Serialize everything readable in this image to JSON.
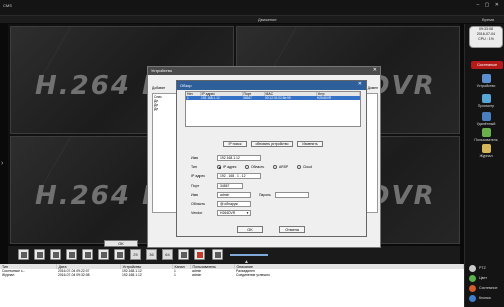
{
  "app": {
    "title": "CMS",
    "menu_center": "Движение",
    "menu_right": "Время"
  },
  "watermark": "H.264 DVR",
  "clock": {
    "time": "09:33:08",
    "date": "2016-07-04",
    "cpu": "CPU : 1%"
  },
  "side_panel": {
    "header": "Системные",
    "buttons": [
      "Устройство",
      "Просмотр",
      "Удалённый",
      "Пользователь",
      "Журнал"
    ],
    "bottom": [
      "PTZ",
      "Цвет",
      "Системное",
      "Кнопка"
    ]
  },
  "toolbar": {
    "nums": [
      "25",
      "36",
      "64"
    ],
    "left_arrow": "›",
    "collapse": "▲"
  },
  "log": {
    "headers": [
      "Тип",
      "Дата",
      "Устройство",
      "Канал",
      "Пользователь",
      "Описание"
    ],
    "rows": [
      [
        "Системные з...",
        "2016-07-04 09:22:07",
        "192.168.1.12",
        "1",
        "admin",
        "Разъединен"
      ],
      [
        "Журнал",
        "2016-07-04 09:32:08",
        "192.168.1.12",
        "1",
        "admin",
        "Соединение успешно"
      ]
    ]
  },
  "outer_dialog": {
    "title": "Устройство",
    "col_left": "Добавит",
    "col_right": "Домен",
    "tree": [
      "Спис",
      "Де",
      "Де",
      "Де"
    ],
    "ok": "OK"
  },
  "inner_dialog": {
    "title": "Обзор",
    "table": {
      "headers": [
        "Нет.",
        "IP адрес",
        "Порт",
        "MAC",
        "Устр"
      ],
      "rows": [
        [
          "1",
          "192.168.1.12",
          "34567",
          "00:12:31:02:8e:99",
          "H264DVR"
        ]
      ]
    },
    "buttons": {
      "search": "IP поиск",
      "refresh": "обновить устройство",
      "modify": "Изменить",
      "ok": "OK",
      "cancel": "Отмена"
    },
    "form": {
      "name_label": "Имя",
      "name_value": "192.168.1.12",
      "type_label": "Тип",
      "type_options": [
        "IP адрес",
        "Область",
        "ARSP",
        "Cloud"
      ],
      "ip_label": "IP адрес",
      "ip_value": "192 . 168 . 1 . 12",
      "port_label": "Порт",
      "port_value": "34567",
      "user_label": "Имя",
      "user_value": "admin",
      "password_label": "Пароль",
      "area_label": "Область",
      "area_value": "@:обнаруж",
      "vendor_label": "Vendor",
      "vendor_value": "H264DVR"
    }
  },
  "colors": {
    "inner_title": "#2f5f9a",
    "selection": "#3472c8",
    "side_header": "#b51a1a"
  }
}
